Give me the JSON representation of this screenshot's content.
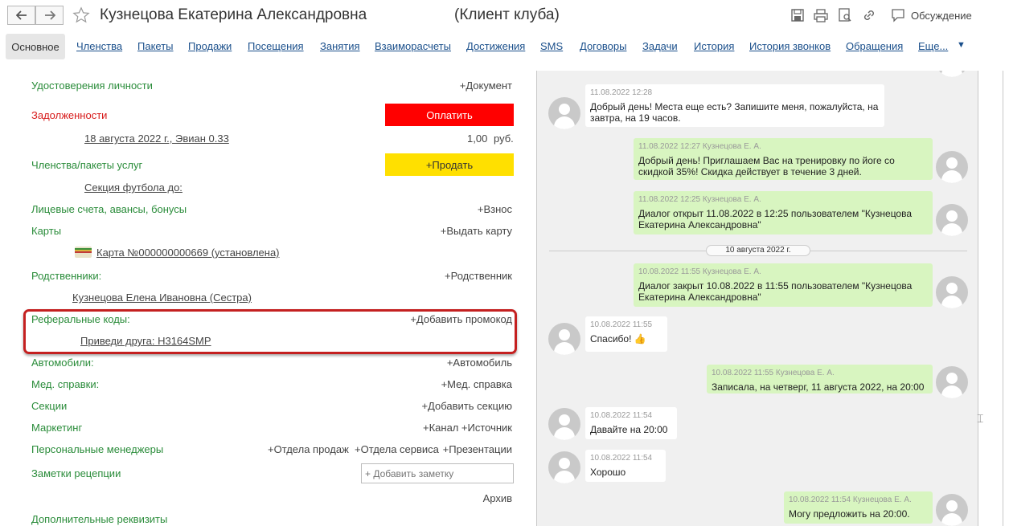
{
  "window": {
    "title": "Кузнецова Екатерина Александровна",
    "subtitle": "(Клиент клуба)",
    "discussion": "Обсуждение"
  },
  "tabs": [
    {
      "label": "Основное"
    },
    {
      "label": "Членства"
    },
    {
      "label": "Пакеты"
    },
    {
      "label": "Продажи"
    },
    {
      "label": "Посещения"
    },
    {
      "label": "Занятия"
    },
    {
      "label": "Взаиморасчеты"
    },
    {
      "label": "Достижения"
    },
    {
      "label": "SMS"
    },
    {
      "label": "Договоры"
    },
    {
      "label": "Задачи"
    },
    {
      "label": "История"
    },
    {
      "label": "История звонков"
    },
    {
      "label": "Обращения"
    },
    {
      "label": "Еще..."
    }
  ],
  "left": {
    "id_docs": {
      "label": "Удостоверения личности",
      "action": "+Документ"
    },
    "debts": {
      "label": "Задолженности",
      "pay": "Оплатить",
      "item": "18 августа 2022 г., Эвиан 0.33",
      "amount": "1,00",
      "currency": "руб."
    },
    "memberships": {
      "label": "Членства/пакеты услуг",
      "sell": "+Продать",
      "item": "Секция футбола  до:"
    },
    "accounts": {
      "label": "Лицевые счета, авансы, бонусы",
      "action": "+Взнос"
    },
    "cards": {
      "label": "Карты",
      "action": "+Выдать карту",
      "item": "Карта №000000000669 (установлена)"
    },
    "relatives": {
      "label": "Родственники:",
      "action": "+Родственник",
      "item": "Кузнецова Елена Ивановна (Сестра)"
    },
    "referral": {
      "label": "Реферальные коды:",
      "action": "+Добавить промокод",
      "item": "Приведи друга: H3164SMP"
    },
    "cars": {
      "label": "Автомобили:",
      "action": "+Автомобиль"
    },
    "medical": {
      "label": "Мед. справки:",
      "action": "+Мед. справка"
    },
    "sections": {
      "label": "Секции",
      "action": "+Добавить секцию"
    },
    "marketing": {
      "label": "Маркетинг",
      "channel": "+Канал",
      "source": "+Источник"
    },
    "managers": {
      "label": "Персональные менеджеры",
      "sales": "+Отдела продаж",
      "service": "+Отдела сервиса",
      "presentation": "+Презентации"
    },
    "notes": {
      "label": "Заметки рецепции",
      "placeholder": "+ Добавить заметку",
      "archive": "Архив"
    },
    "extra": {
      "label": "Дополнительные реквизиты"
    }
  },
  "chat": {
    "messages": [
      {
        "meta": "11.08.2022 12:28",
        "text": "Добрый день! Места еще есть? Запишите меня, пожалуйста, на завтра, на 19 часов."
      },
      {
        "meta": "11.08.2022 12:27 Кузнецова Е. А.",
        "text": "Добрый день! Приглашаем Вас на тренировку по йоге со скидкой 35%! Скидка действует в течение 3 дней."
      },
      {
        "meta": "11.08.2022 12:25 Кузнецова Е. А.",
        "text": "Диалог открыт 11.08.2022 в 12:25 пользователем \"Кузнецова Екатерина Александровна\""
      },
      {
        "meta": "10.08.2022 11:55 Кузнецова Е. А.",
        "text": "Диалог закрыт 10.08.2022 в 11:55 пользователем \"Кузнецова Екатерина Александровна\""
      },
      {
        "meta": "10.08.2022 11:55",
        "text": "Спасибо!",
        "emoji": "👍"
      },
      {
        "meta": "10.08.2022 11:55 Кузнецова Е. А.",
        "text": "Записала, на четверг, 11 августа 2022, на 20:00"
      },
      {
        "meta": "10.08.2022 11:54",
        "text": "Давайте на 20:00"
      },
      {
        "meta": "10.08.2022 11:54",
        "text": "Хорошо"
      },
      {
        "meta": "10.08.2022 11:54 Кузнецова Е. А.",
        "text": "Могу предложить на 20:00."
      }
    ],
    "date_separator": "10 августа 2022 г."
  },
  "icons": {
    "back": "arrow-left-icon",
    "forward": "arrow-right-icon",
    "favorite": "star-icon",
    "save": "save-icon",
    "print": "print-icon",
    "preview": "report-icon",
    "link": "link-icon",
    "discussion": "chat-icon"
  },
  "colors": {
    "pay_button": "#ff0000",
    "sell_button": "#ffe000",
    "label_green": "#2a8c3a",
    "debt_red": "#d71a1a",
    "highlight_border": "#c42020",
    "outgoing_bubble": "#d8f5c0"
  }
}
